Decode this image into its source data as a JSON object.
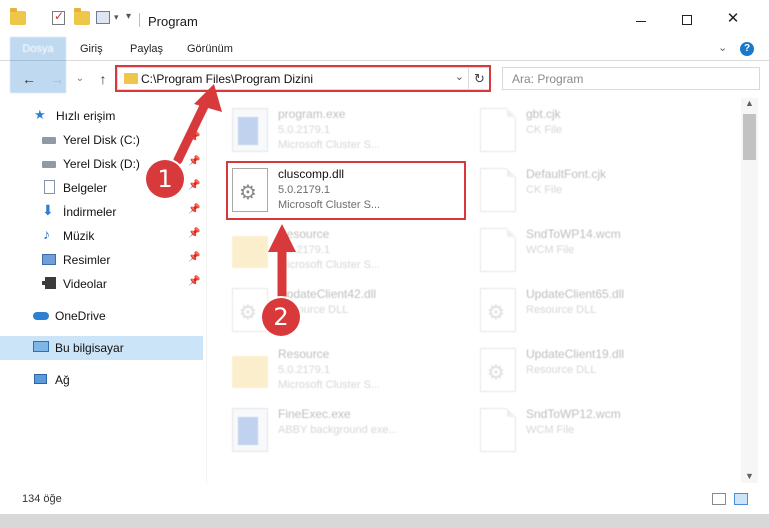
{
  "window": {
    "title": "Program",
    "controls": {
      "minimize": "minimize-icon",
      "maximize": "maximize-icon",
      "close": "✕"
    }
  },
  "ribbon": {
    "tabs": [
      "Dosya",
      "Giriş",
      "Paylaş",
      "Görünüm"
    ],
    "help": "?"
  },
  "nav": {
    "back": "←",
    "forward": "→",
    "recent": "⌄",
    "up": "↑",
    "address": "C:\\Program Files\\Program Dizini",
    "address_dropdown": "⌄",
    "refresh": "↻",
    "search_placeholder": "Ara: Program"
  },
  "sidebar": {
    "items": [
      {
        "label": "Hızlı erişim",
        "icon": "star-icon"
      },
      {
        "label": "Yerel Disk (C:)",
        "icon": "drive-icon",
        "pinned": true
      },
      {
        "label": "Yerel Disk (D:)",
        "icon": "drive-icon",
        "pinned": true
      },
      {
        "label": "Belgeler",
        "icon": "documents-icon",
        "pinned": true
      },
      {
        "label": "İndirmeler",
        "icon": "download-icon",
        "pinned": true
      },
      {
        "label": "Müzik",
        "icon": "music-icon",
        "pinned": true
      },
      {
        "label": "Resimler",
        "icon": "pictures-icon",
        "pinned": true
      },
      {
        "label": "Videolar",
        "icon": "videos-icon",
        "pinned": true
      },
      {
        "label": "OneDrive",
        "icon": "onedrive-icon"
      },
      {
        "label": "Bu bilgisayar",
        "icon": "computer-icon",
        "selected": true
      },
      {
        "label": "Ağ",
        "icon": "network-icon"
      }
    ]
  },
  "files": [
    {
      "name": "program.exe",
      "line2": "5.0.2179.1",
      "line3": "Microsoft Cluster S...",
      "icon": "exe-icon"
    },
    {
      "name": "gbt.cjk",
      "line2": "CK File",
      "line3": "",
      "icon": "file-icon"
    },
    {
      "name": "cluscomp.dll",
      "line2": "5.0.2179.1",
      "line3": "Microsoft Cluster S...",
      "icon": "dll-gear-icon",
      "highlighted": true
    },
    {
      "name": "DefaultFont.cjk",
      "line2": "CK File",
      "line3": "",
      "icon": "file-icon"
    },
    {
      "name": "Resource",
      "line2": "5.0.2179.1",
      "line3": "Microsoft Cluster S...",
      "icon": "folder-icon"
    },
    {
      "name": "SndToWP14.wcm",
      "line2": "WCM File",
      "line3": "",
      "icon": "file-icon"
    },
    {
      "name": "UpdateClient42.dll",
      "line2": "Resource DLL",
      "line3": "",
      "icon": "dll-gear-icon"
    },
    {
      "name": "UpdateClient65.dll",
      "line2": "Resource DLL",
      "line3": "",
      "icon": "dll-gear-icon"
    },
    {
      "name": "Resource",
      "line2": "5.0.2179.1",
      "line3": "Microsoft Cluster S...",
      "icon": "folder-icon"
    },
    {
      "name": "UpdateClient19.dll",
      "line2": "Resource DLL",
      "line3": "",
      "icon": "dll-gear-icon"
    },
    {
      "name": "FineExec.exe",
      "line2": "ABBY background exe...",
      "line3": "",
      "icon": "exe-icon"
    },
    {
      "name": "SndToWP12.wcm",
      "line2": "WCM File",
      "line3": "",
      "icon": "file-icon"
    }
  ],
  "status": {
    "count": "134 öğe"
  },
  "annotations": {
    "step1": "1",
    "step2": "2",
    "accent": "#d83a3c"
  }
}
